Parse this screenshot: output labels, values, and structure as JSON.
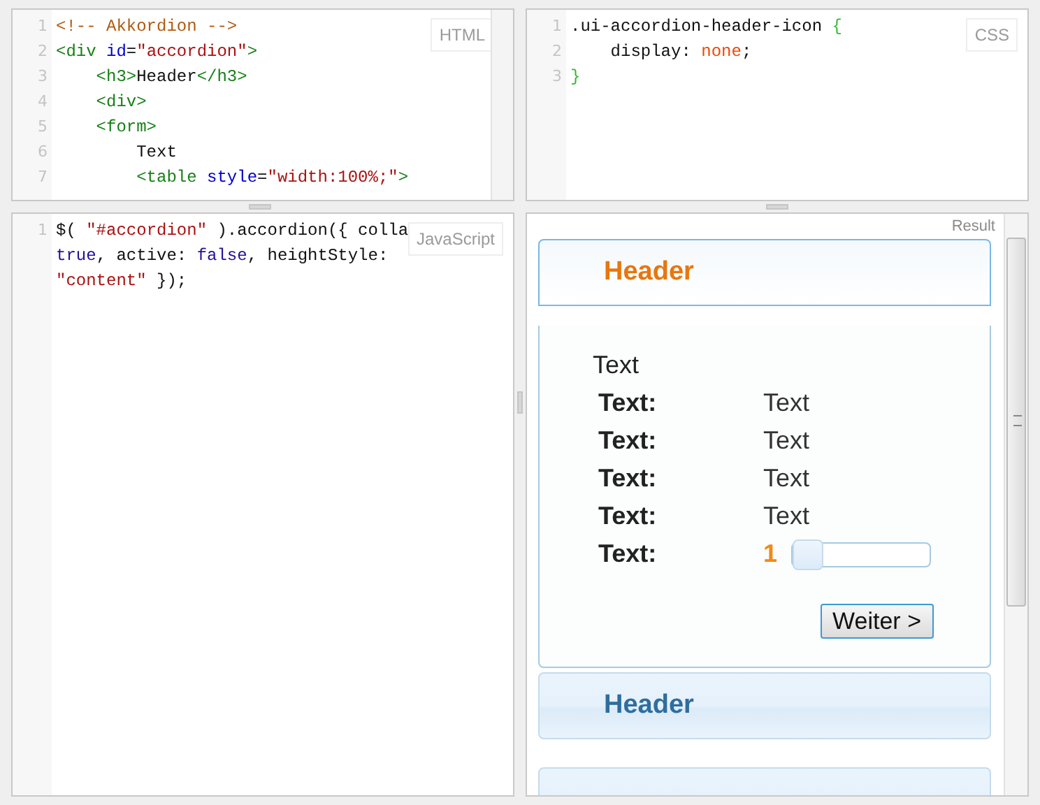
{
  "editors": [
    {
      "label": "HTML",
      "scrollbar": true,
      "lines": [
        {
          "number": "1",
          "tokens": [
            {
              "text": "<!-- Akkordion -->",
              "kind": "comment"
            }
          ]
        },
        {
          "number": "2",
          "tokens": [
            {
              "text": "<div ",
              "kind": "tag"
            },
            {
              "text": "id",
              "kind": "attr"
            },
            {
              "text": "=",
              "kind": "plain"
            },
            {
              "text": "\"accordion\"",
              "kind": "string"
            },
            {
              "text": ">",
              "kind": "tag"
            }
          ]
        },
        {
          "number": "3",
          "tokens": [
            {
              "text": "    <h3>",
              "kind": "tag"
            },
            {
              "text": "Header",
              "kind": "plain"
            },
            {
              "text": "</h3>",
              "kind": "tag"
            }
          ]
        },
        {
          "number": "4",
          "tokens": [
            {
              "text": "    <div>",
              "kind": "tag"
            }
          ]
        },
        {
          "number": "5",
          "tokens": [
            {
              "text": "    <form>",
              "kind": "tag"
            }
          ]
        },
        {
          "number": "6",
          "tokens": [
            {
              "text": "        Text",
              "kind": "plain"
            }
          ]
        },
        {
          "number": "7",
          "tokens": [
            {
              "text": "        <table",
              "kind": "tag"
            },
            {
              "text": " style",
              "kind": "attr"
            },
            {
              "text": "=",
              "kind": "plain"
            },
            {
              "text": "\"width:100%;\"",
              "kind": "string"
            },
            {
              "text": ">",
              "kind": "tag"
            }
          ]
        }
      ]
    },
    {
      "label": "CSS",
      "scrollbar": false,
      "lines": [
        {
          "number": "1",
          "tokens": [
            {
              "text": ".ui-accordion-header-icon ",
              "kind": "plain"
            },
            {
              "text": "{",
              "kind": "bracket"
            }
          ]
        },
        {
          "number": "2",
          "tokens": [
            {
              "text": "    display: ",
              "kind": "plain"
            },
            {
              "text": "none",
              "kind": "value"
            },
            {
              "text": ";",
              "kind": "plain"
            }
          ]
        },
        {
          "number": "3",
          "tokens": [
            {
              "text": "}",
              "kind": "bracket"
            }
          ]
        }
      ]
    },
    {
      "label": "JavaScript",
      "scrollbar": false,
      "lines": [
        {
          "number": "1",
          "tokens": [
            {
              "text": "$( ",
              "kind": "plain"
            },
            {
              "text": "\"#accordion\"",
              "kind": "string"
            },
            {
              "text": " ).accordion({ colla",
              "kind": "plain"
            },
            {
              "kind": "break"
            },
            {
              "text": "true",
              "kind": "atom"
            },
            {
              "text": ", active: ",
              "kind": "plain"
            },
            {
              "text": "false",
              "kind": "atom"
            },
            {
              "text": ", heightStyle:",
              "kind": "plain"
            },
            {
              "kind": "break"
            },
            {
              "text": "\"content\"",
              "kind": "string"
            },
            {
              "text": " });",
              "kind": "plain"
            }
          ]
        }
      ]
    }
  ],
  "result": {
    "label": "Result",
    "sections": [
      {
        "header": "Header",
        "selected": true,
        "content": {
          "intro": "Text",
          "rows": [
            {
              "kind": "text",
              "label": "Text:",
              "value": "Text"
            },
            {
              "kind": "text",
              "label": "Text:",
              "value": "Text"
            },
            {
              "kind": "text",
              "label": "Text:",
              "value": "Text"
            },
            {
              "kind": "text",
              "label": "Text:",
              "value": "Text"
            },
            {
              "kind": "slider",
              "label": "Text:",
              "value": "1",
              "level": 0
            }
          ],
          "button": "Weiter >"
        }
      },
      {
        "header": "Header",
        "selected": false
      },
      {
        "selected": false
      }
    ]
  }
}
